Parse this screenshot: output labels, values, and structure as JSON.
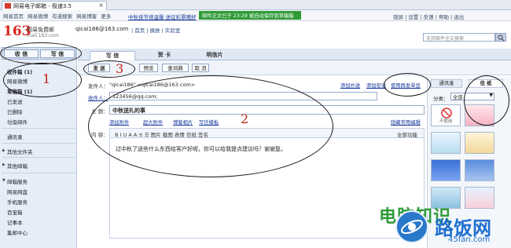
{
  "browser": {
    "tab_title": "网易电子邮箱 - 极速3.5",
    "tab_close": "×"
  },
  "topnav": {
    "links": [
      "网易首页",
      "网易微博",
      "有道搜索",
      "网易博客",
      "更多"
    ],
    "notice": "中秋佳节倍温馨 送征彩票赠好",
    "save_status": "邮件正文已于 23:29 被自动保存到草稿箱",
    "right_links": "锁屏 | 设置 | 反馈 | 帮助 | 退出"
  },
  "header": {
    "logo": "163",
    "logo_title": "网易免费邮",
    "logo_domain": "mail.163.com",
    "user_email": "qicai186@163.com",
    "links": "| 首页 | 换肤 | 实验室",
    "search_placeholder": "支持邮件全文搜索"
  },
  "sidebar": {
    "receive_label": "收 信",
    "write_label": "写 信",
    "items": [
      "收件箱 (1)",
      "网易微博",
      "草稿箱 (1)",
      "已发送",
      "已删除",
      "垃圾邮件",
      "通讯录",
      "其他文件夹",
      "其他邮箱",
      "邮箱服务",
      "网易网盘",
      "手机服务",
      "百宝箱",
      "记事本",
      "集邮中心"
    ]
  },
  "compose": {
    "tabs": [
      "写 信",
      "贺 卡",
      "明信片"
    ],
    "buttons": {
      "send": "发 送",
      "preview": "预览",
      "lookup": "查词典",
      "cancel": "取 消"
    },
    "from_label": "发件人：",
    "from_value": "\"qicai186\" <qicai186@163.com>",
    "to_label": "收件人：",
    "to_value": "123456@qq.com;",
    "subject_label": "主 题：",
    "subject_value": "中秋送礼的事",
    "content_label": "内 容：",
    "add_cc": "添加抄送",
    "add_bcc": "添加密送",
    "mass_send": "使用群发单显",
    "add_attachment": "添加附件",
    "large_attachment": "超大附件",
    "web_album": "博客相片",
    "insert_template": "写信模板",
    "hide_links": "隐藏常用编辑",
    "all_features": "全部功能",
    "editor_tools": "B  I  U  A  A  ≡  ☰  图片  截图  表情  信纸  签名",
    "body_text": "过中秋了送些什么东西给客户好呢，你可以给我提点建议吗？谢谢复。"
  },
  "rpanel": {
    "tab_contacts": "通讯录",
    "tab_stationery": "信 纸",
    "category_label": "分类：",
    "category_value": "全部",
    "none_label": "不使用"
  },
  "annotations": {
    "n1": "1",
    "n2": "2",
    "n3": "3"
  },
  "watermark": {
    "brand": "电脑知识",
    "cn": "路饭网",
    "url": "45fan.com"
  }
}
